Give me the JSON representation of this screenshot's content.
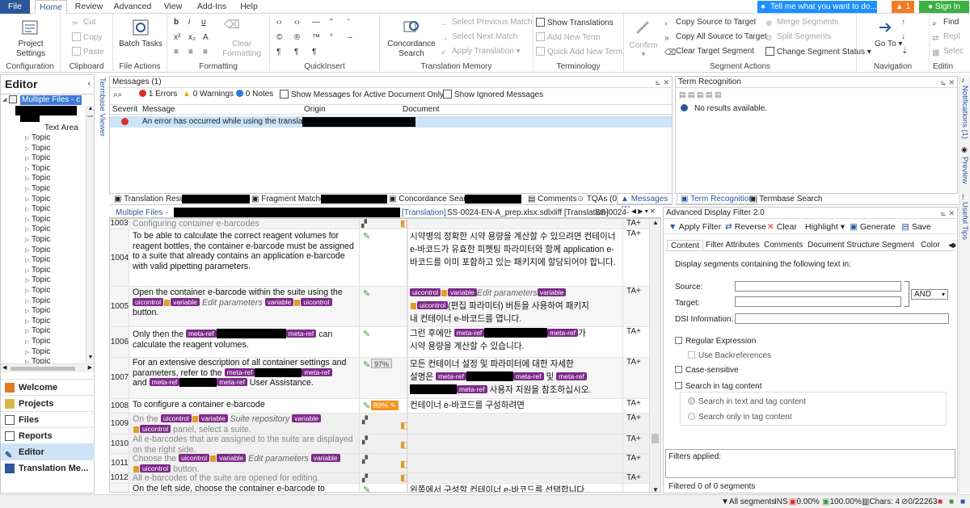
{
  "tabs": [
    "File",
    "Home",
    "Review",
    "Advanced",
    "View",
    "Add-Ins",
    "Help"
  ],
  "tell_me": "Tell me what you want to do...",
  "notif_count": "1",
  "sign_in": "Sign In",
  "ribbon": {
    "configuration": {
      "label": "Configuration",
      "project_settings": "Project Settings"
    },
    "clipboard": {
      "label": "Clipboard",
      "cut": "Cut",
      "copy": "Copy",
      "paste": "Paste"
    },
    "file_actions": {
      "label": "File Actions",
      "batch_tasks": "Batch Tasks"
    },
    "formatting": {
      "label": "Formatting",
      "clear_formatting": "Clear Formatting"
    },
    "quickinsert": {
      "label": "QuickInsert"
    },
    "translation_memory": {
      "label": "Translation Memory",
      "concordance_search": "Concordance Search",
      "select_prev": "Select Previous Match",
      "select_next": "Select Next Match",
      "apply_translation": "Apply Translation"
    },
    "terminology": {
      "label": "Terminology",
      "show_translations": "Show Translations",
      "add_new_term": "Add New Term",
      "quick_add": "Quick Add New Term"
    },
    "segment_actions": {
      "label": "Segment Actions",
      "confirm": "Confirm",
      "copy_source": "Copy Source to Target",
      "copy_all_source": "Copy All Source to Target",
      "clear_target": "Clear Target Segment",
      "merge": "Merge Segments",
      "split": "Split Segments",
      "change_status": "Change Segment Status"
    },
    "navigation": {
      "label": "Navigation",
      "go_to": "Go To"
    },
    "editing": {
      "label": "Editin",
      "find": "Find",
      "replace": "Repl",
      "select": "Selec"
    }
  },
  "editor": {
    "title": "Editor",
    "tree_root": "Multiple Files - c",
    "tree_text_area": "Text Area",
    "topic_label": "Topic",
    "nav": [
      "Welcome",
      "Projects",
      "Files",
      "Reports",
      "Editor",
      "Translation Me..."
    ]
  },
  "termbase_viewer": "Termbase Viewer",
  "messages": {
    "title": "Messages (1)",
    "errors": "1 Errors",
    "warnings": "0 Warnings",
    "notes": "0 Notes",
    "active_only": "Show Messages for Active Document Only",
    "ignored": "Show Ignored Messages",
    "cols": [
      "Severit",
      "Message",
      "Origin",
      "Document"
    ],
    "row_msg": "An error has occurred while using the translatio..."
  },
  "term_recognition": {
    "title": "Term Recognition",
    "no_results": "No results available."
  },
  "bottom_tabs": [
    "Translation Results",
    "Fragment Matches",
    "Concordance Search",
    "Comments",
    "TQAs (0)",
    "Messages (1)"
  ],
  "right_bottom_tabs": [
    "Term Recognition",
    "Termbase Search"
  ],
  "doc_tabs": [
    "Multiple Files -",
    "[Translation]",
    "SS-0024-EN-A_prep.xlsx.sdlxliff [Translation]",
    "SS-0024-"
  ],
  "segments": [
    {
      "n": "1003",
      "src": "Configuring container e-barcodes",
      "tgt": "",
      "ta": "TA+"
    },
    {
      "n": "1004",
      "src": "To be able to calculate the correct reagent volumes for reagent bottles, the container e-barcode must be assigned to a suite that already contains an application e-barcode with valid pipetting parameters.",
      "tgt": "시약병의 정확한 시약 용량을 계산할 수 있으려면 컨테이너 e-바코드가 유효한 피펫팅 파라미터와 함께 application e-바코드를 이미 포함하고 있는 패키지에 할당되어야 합니다.",
      "ta": "TA+"
    },
    {
      "n": "1005",
      "src_a": "Open the container e-barcode within the suite using the",
      "src_b": "button.",
      "tgt_a": "(편집 파라미터) 버튼을 사용하여 패키지",
      "tgt_b": "내 컨테이너 e-바코드를 엽니다.",
      "ta": "TA+"
    },
    {
      "n": "1006",
      "src_a": "Only then the",
      "src_b": "can",
      "src_c": "calculate the reagent volumes.",
      "tgt_a": "그런 후에만",
      "tgt_b": "가",
      "tgt_c": "시약 용량을 계산할 수 있습니다.",
      "ta": "TA+"
    },
    {
      "n": "1007",
      "src_a": "For an extensive description of all container settings and parameters, refer to the",
      "src_b": "and",
      "src_c": "User Assistance.",
      "pct": "97%",
      "tgt_a": "모든 컨테이너 설정 및 파라미터에 대한 자세한",
      "tgt_b": "설명은",
      "tgt_c": "및",
      "tgt_d": "사용자 지원을 참조하십시오.",
      "ta": "TA+"
    },
    {
      "n": "1008",
      "src": "To configure a container e-barcode",
      "pct": "89%",
      "tgt": "컨테이너 e-바코드를 구성하려면",
      "ta": "TA+"
    },
    {
      "n": "1009",
      "src_a": "On the",
      "src_b": "panel, select a suite.",
      "ta": "TA+"
    },
    {
      "n": "1010",
      "src": "All e-barcodes that are assigned to the suite are displayed on the right side.",
      "ta": "TA+"
    },
    {
      "n": "1011",
      "src_a": "Choose the",
      "src_b": "button.",
      "ta": "TA+"
    },
    {
      "n": "1012",
      "src": "All e-barcodes of the suite are opened for editing.",
      "ta": "TA+"
    },
    {
      "n": "1013",
      "src": "On the left side, choose the container e-barcode to",
      "tgt": "왼쪽에서 구성할 컨테이너 e-바코드를 선택합니다",
      "ta": ""
    }
  ],
  "tags": {
    "uicontrol": "uicontrol",
    "variable": "variable",
    "meta_ref": "meta-ref",
    "edit_params": "Edit parameters",
    "suite_repo": "Suite repository"
  },
  "filter": {
    "title": "Advanced Display Filter 2.0",
    "apply": "Apply Filter",
    "reverse": "Reverse",
    "clear": "Clear",
    "highlight": "Highlight",
    "generate": "Generate",
    "save": "Save",
    "tabs": [
      "Content",
      "Filter Attributes",
      "Comments",
      "Document Structure",
      "Segment",
      "Color"
    ],
    "desc": "Display segments containing the following text in:",
    "source": "Source:",
    "target": "Target:",
    "dsi": "DSI Information:",
    "op": "AND",
    "regex": "Regular Expression",
    "backref": "Use Backreferences",
    "case": "Case-sensitive",
    "tag": "Search in tag content",
    "r1": "Search in text and tag content",
    "r2": "Search only in tag content",
    "applied": "Filters applied:",
    "count": "Filtered 0 of 0 segments"
  },
  "side_tabs": [
    "Notifications (1)",
    "Preview",
    "Useful Tips"
  ],
  "status": {
    "all_segments": "All segments",
    "ins": "INS",
    "p1": "0.00%",
    "p2": "100.00%",
    "chars": "Chars: 4",
    "words": "0/22263"
  },
  "colors": {
    "accent": "#2b579a",
    "tag": "#7e2a8a",
    "fuzzy": "#f7941d",
    "error": "#d9302c"
  }
}
